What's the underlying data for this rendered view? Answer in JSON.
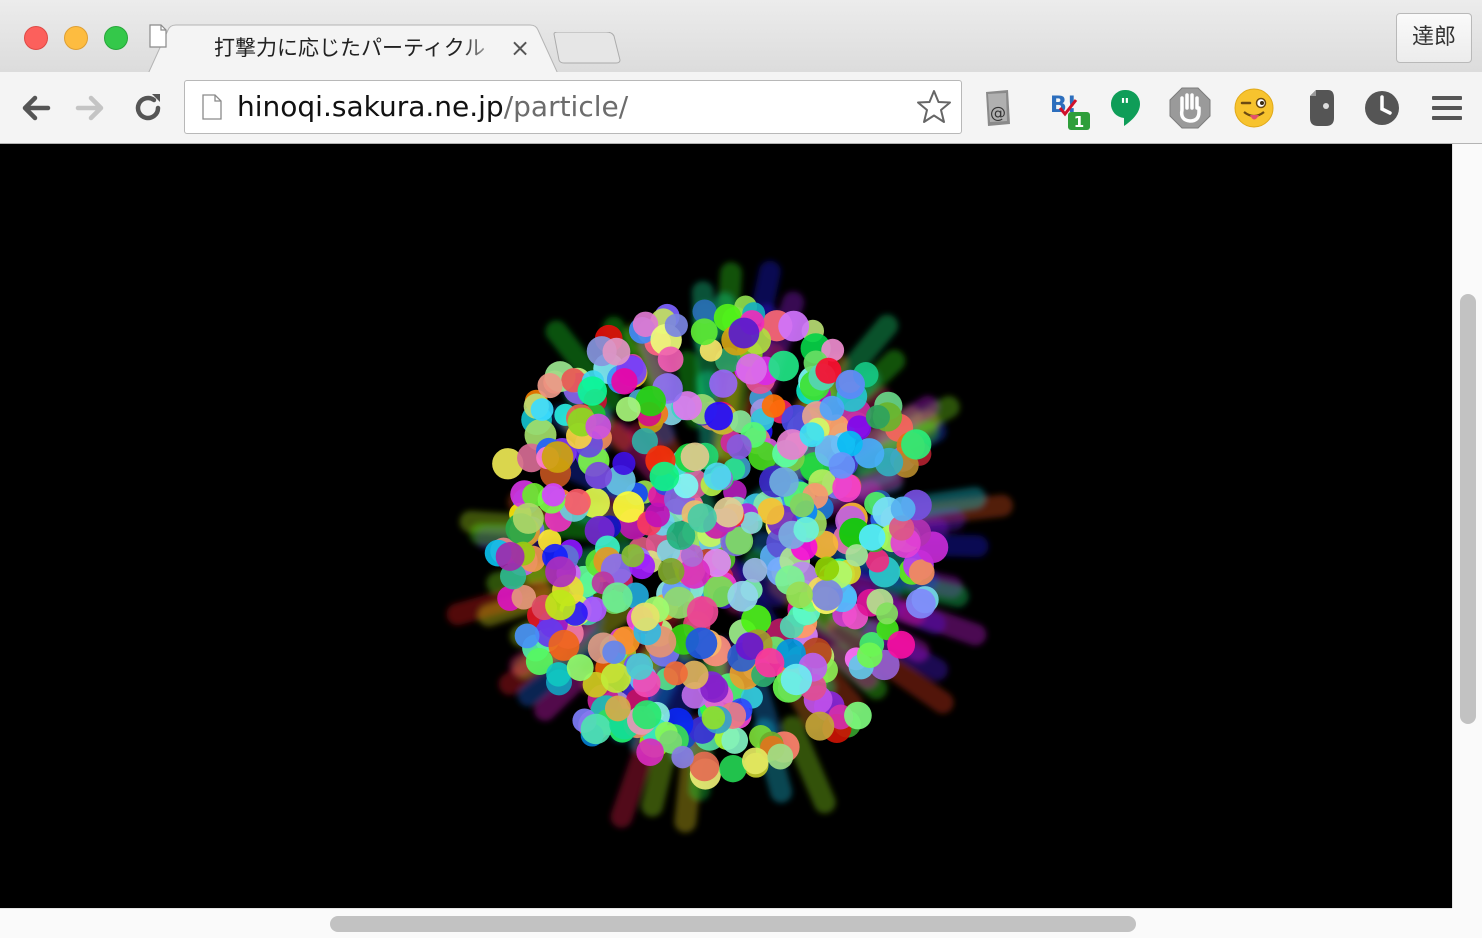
{
  "browser": {
    "tab": {
      "title": "打撃力に応じたパーティクル",
      "close_glyph": "×"
    },
    "profile": {
      "name": "達郎"
    },
    "address_bar": {
      "host": "hinoqi.sakura.ne.jp",
      "path": "/particle/"
    },
    "extensions": [
      "sendto-icon",
      "hatena-bookmark-icon",
      "hangouts-icon",
      "adblock-hand-icon",
      "emoji-face-icon",
      "evernote-icon",
      "history-clock-icon"
    ],
    "extension_badge": "1"
  },
  "scene": {
    "background": "#000000",
    "description_colors": [
      "#ff2d55",
      "#00e5ff",
      "#7cfc00",
      "#ff00ff",
      "#4169e1",
      "#ffd700",
      "#ff4500",
      "#00fa9a",
      "#9370db",
      "#ffb6c1"
    ]
  }
}
